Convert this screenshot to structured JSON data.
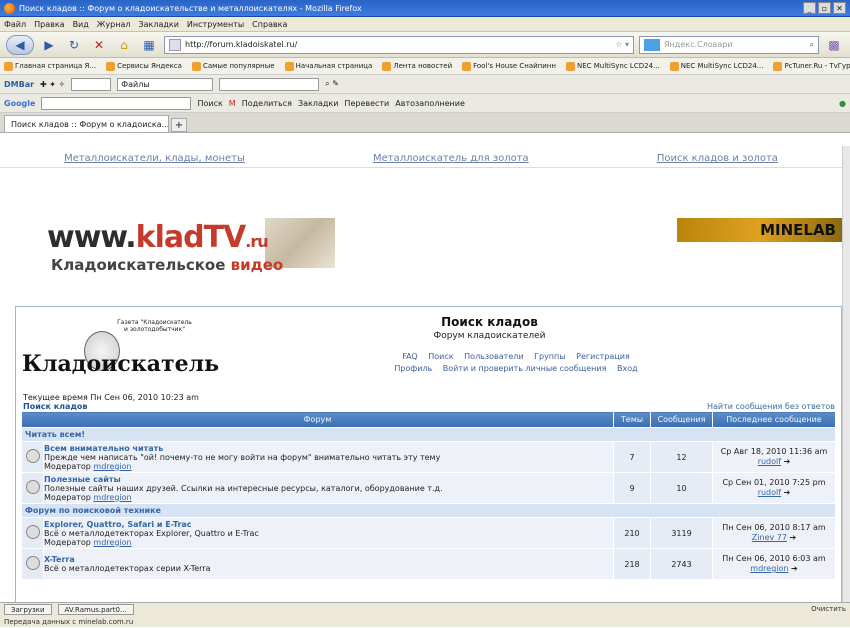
{
  "window": {
    "title": "Поиск кладов :: Форум о кладоискательстве и металлоискателях - Mozilla Firefox",
    "buttons": [
      "_",
      "▫",
      "✕"
    ]
  },
  "menu": [
    "Файл",
    "Правка",
    "Вид",
    "Журнал",
    "Закладки",
    "Инструменты",
    "Справка"
  ],
  "nav": {
    "url": "http://forum.kladoiskatel.ru/",
    "search_placeholder": "Яндекс.Словари"
  },
  "bookmarks": [
    "Главная страница Я...",
    "Сервисы Яндекса",
    "Самые популярные",
    "Начальная страница",
    "Лента новостей",
    "Fool's House Снайпинн",
    "NEC MultiSync LCD24...",
    "NEC MultiSync LCD24...",
    "PcTuner.Ru - TvГуру ..."
  ],
  "toolbar1": {
    "label": "DMBar",
    "files": "Файлы"
  },
  "toolbar2": {
    "label": "Google",
    "items": [
      "Поиск",
      "Поделиться",
      "Закладки",
      "Перевести",
      "Автозаполнение"
    ]
  },
  "tab": {
    "title": "Поиск кладов :: Форум о кладоиска..."
  },
  "topnav": [
    "Металлоискатели, клады, монеты",
    "Металлоискатель для золота",
    "Поиск кладов и золота"
  ],
  "banner1": {
    "www": "www.",
    "klad": "kladTV",
    "ru": ".ru",
    "sub1": "Кладоискательское",
    "sub2": "видео"
  },
  "banner2": {
    "brand": "MINELAB"
  },
  "forum": {
    "logo_text": "Кладоискатель",
    "gazeta": "Газета \"Кладоискатель и золотодобытчик\"",
    "title": "Поиск кладов",
    "subtitle": "Форум кладоискателей",
    "links1": [
      "FAQ",
      "Поиск",
      "Пользователи",
      "Группы",
      "Регистрация"
    ],
    "links2": [
      "Профиль",
      "Войти и проверить личные сообщения",
      "Вход"
    ],
    "current_time": "Текущее время Пн Сен 06, 2010 10:23 am",
    "breadcrumb": "Поиск кладов",
    "no_answer": "Найти сообщения без ответов",
    "headers": [
      "Форум",
      "Темы",
      "Сообщения",
      "Последнее сообщение"
    ],
    "categories": [
      {
        "name": "Читать всем!",
        "forums": [
          {
            "name": "Всем внимательно читать",
            "desc": "Прежде чем написать \"ой! почему-то не могу войти на форум\" внимательно читать эту тему",
            "mod_label": "Модератор",
            "mod": "mdregion",
            "topics": "7",
            "posts": "12",
            "last_date": "Ср Авг 18, 2010 11:36 am",
            "last_user": "rudolf"
          },
          {
            "name": "Полезные сайты",
            "desc": "Полезные сайты наших друзей. Ссылки на интересные ресурсы, каталоги, оборудование т.д.",
            "mod_label": "Модератор",
            "mod": "mdregion",
            "topics": "9",
            "posts": "10",
            "last_date": "Ср Сен 01, 2010 7:25 pm",
            "last_user": "rudolf"
          }
        ]
      },
      {
        "name": "Форум по поисковой технике",
        "forums": [
          {
            "name": "Explorer, Quattro, Safari и E-Trac",
            "desc": "Всё о металлодетекторах Explorer, Quattro и E-Trac",
            "mod_label": "Модератор",
            "mod": "mdregion",
            "topics": "210",
            "posts": "3119",
            "last_date": "Пн Сен 06, 2010 8:17 am",
            "last_user": "Zinev 77"
          },
          {
            "name": "X-Terra",
            "desc": "Всё о металлодетекторах серии X-Terra",
            "mod_label": "",
            "mod": "",
            "topics": "218",
            "posts": "2743",
            "last_date": "Пн Сен 06, 2010 6:03 am",
            "last_user": "mdregion"
          }
        ]
      }
    ]
  },
  "status": {
    "downloads": "Загрузки",
    "file": "AV.Ramus.part0...",
    "done": "Передача данных с minelab.com.ru",
    "clear": "Очистить"
  }
}
